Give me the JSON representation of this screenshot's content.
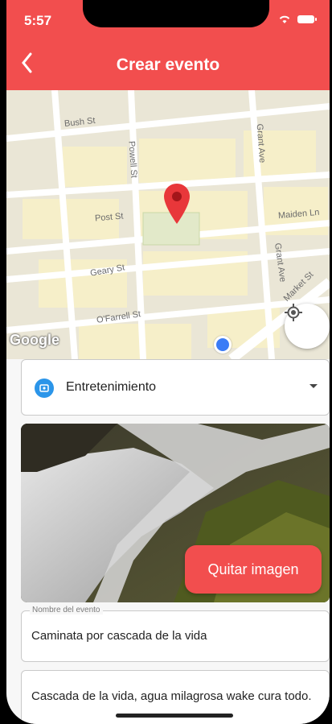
{
  "status_bar": {
    "time": "5:57"
  },
  "header": {
    "back_label": "‹",
    "title": "Crear evento"
  },
  "map": {
    "streets": [
      "Bush St",
      "Powell St",
      "Grant Ave",
      "Post St",
      "Maiden Ln",
      "Geary St",
      "Grant Ave",
      "O'Farrell St",
      "Market St"
    ],
    "attribution": "Google"
  },
  "form": {
    "category_value": "Entretenimiento",
    "remove_image_label": "Quitar imagen",
    "name_label": "Nombre del evento",
    "name_value": "Caminata por cascada de la vida",
    "description_value": "Cascada de la vida, agua milagrosa wake cura todo."
  },
  "colors": {
    "accent": "#f24e4e",
    "category_icon": "#2b95e9"
  }
}
